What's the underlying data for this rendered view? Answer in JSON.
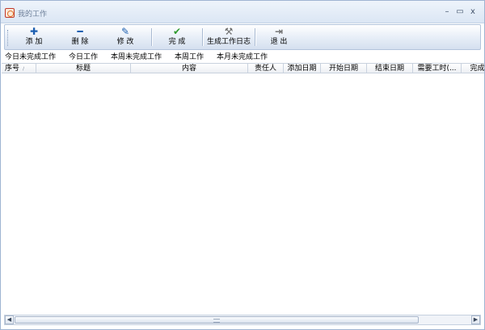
{
  "window": {
    "title": "我的工作",
    "controls": {
      "minimize": "–",
      "restore": "▭",
      "close": "x"
    }
  },
  "toolbar": {
    "buttons": [
      {
        "label": "添 加",
        "icon": "plus-icon",
        "glyph": "✚",
        "color": "#1d5fb0"
      },
      {
        "label": "删 除",
        "icon": "minus-icon",
        "glyph": "━",
        "color": "#1d5fb0"
      },
      {
        "label": "修 改",
        "icon": "pen-icon",
        "glyph": "✎",
        "color": "#1d5fb0"
      },
      {
        "label": "完 成",
        "icon": "check-icon",
        "glyph": "✔",
        "color": "#2f9a2f"
      },
      {
        "label": "生成工作日志",
        "icon": "hammer-icon",
        "glyph": "⚒",
        "color": "#6d6d6d"
      },
      {
        "label": "退 出",
        "icon": "exit-icon",
        "glyph": "⇥",
        "color": "#6b6b6b"
      }
    ]
  },
  "tabs": [
    "今日未完成工作",
    "今日工作",
    "本周未完成工作",
    "本周工作",
    "本月未完成工作"
  ],
  "grid": {
    "columns": [
      "序号",
      "标题",
      "内容",
      "责任人",
      "添加日期",
      "开始日期",
      "结束日期",
      "需要工时(...",
      "完成"
    ],
    "sort_indicator": "∕",
    "rows": []
  },
  "scrollbar": {
    "left_arrow": "◀",
    "right_arrow": "▶"
  }
}
